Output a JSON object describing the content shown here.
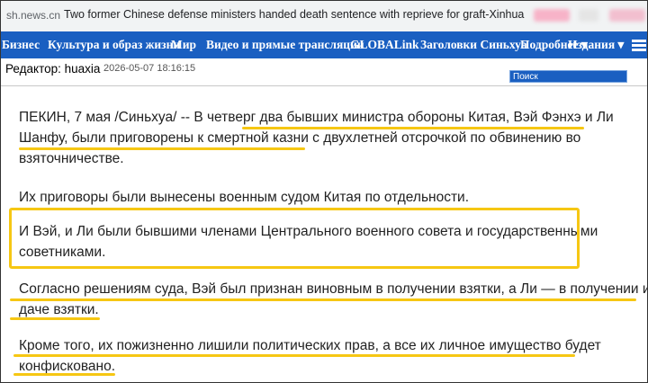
{
  "browser": {
    "url_fragment": "sh.news.cn",
    "tab_title": "Two former Chinese defense ministers handed death sentence with reprieve for graft-Xinhua"
  },
  "nav": {
    "items": [
      "Бизнес",
      "Культура и образ жизни",
      "Мир",
      "Видео и прямые трансляции",
      "GLOBALink",
      "Заголовки Синьхуа",
      "Подробнее ▾",
      "Издания ▾"
    ],
    "menu_icon": "hamburger-icon"
  },
  "meta": {
    "editor": "Редактор: huaxia",
    "datetime": "2026-05-07 18:16:15",
    "search_placeholder": "Поиск"
  },
  "article": {
    "p1": [
      "ПЕКИН, 7 мая /Синьхуа/ -- В четверг два бывших министра обороны Китая, Вэй Фэнхэ и Ли",
      "Шанфу, были приговорены к смертной казни с двухлетней отсрочкой по обвинению во",
      "взяточничестве."
    ],
    "p2": [
      "Их приговоры были вынесены военным судом Китая по отдельности."
    ],
    "p3": [
      "И Вэй, и Ли были бывшими членами Центрального военного совета и государственными",
      "советниками."
    ],
    "p4": [
      "Согласно решениям суда, Вэй был признан виновным в получении взятки, а Ли — в получении и",
      "даче взятки."
    ],
    "p5": [
      "Кроме того, их пожизненно лишили политических прав, а все их личное имущество будет",
      "конфисковано."
    ]
  },
  "colors": {
    "nav_blue": "#1a5fc1",
    "highlight_yellow": "#f6c713"
  }
}
